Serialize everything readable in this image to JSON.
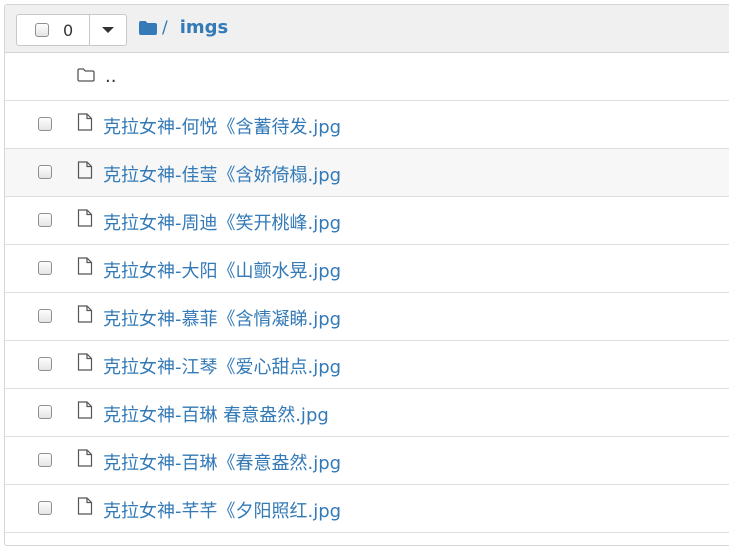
{
  "toolbar": {
    "selected_count": "0"
  },
  "breadcrumb": {
    "separator": "/",
    "current": "imgs"
  },
  "parent_dir": {
    "label": ".."
  },
  "files": [
    {
      "name": "克拉女神-何悦《含蓄待发.jpg"
    },
    {
      "name": "克拉女神-佳莹《含娇倚榻.jpg"
    },
    {
      "name": "克拉女神-周迪《笑开桃峰.jpg"
    },
    {
      "name": "克拉女神-大阳《山颤水晃.jpg"
    },
    {
      "name": "克拉女神-慕菲《含情凝睇.jpg"
    },
    {
      "name": "克拉女神-江琴《爱心甜点.jpg"
    },
    {
      "name": "克拉女神-百琳 春意盎然.jpg"
    },
    {
      "name": "克拉女神-百琳《春意盎然.jpg"
    },
    {
      "name": "克拉女神-芊芊《夕阳照红.jpg"
    }
  ],
  "colors": {
    "link": "#337ab7",
    "header_bg": "#f0f0f0",
    "row_alt": "#f7f7f7",
    "border": "#dddddd"
  }
}
